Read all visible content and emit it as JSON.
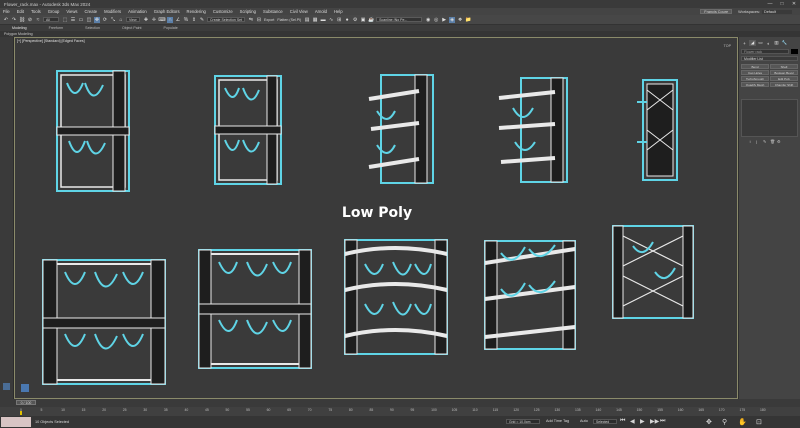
{
  "window": {
    "title": "Flower_rack.max - Autodesk 3ds Max 2024",
    "controls": [
      "—",
      "□",
      "✕"
    ]
  },
  "menu": {
    "items": [
      "File",
      "Edit",
      "Tools",
      "Group",
      "Views",
      "Create",
      "Modifiers",
      "Animation",
      "Graph Editors",
      "Rendering",
      "Customize",
      "Scripting",
      "Substance",
      "Civil View",
      "Arnold",
      "Help"
    ],
    "user": "Francis Coure",
    "workspaces_label": "Workspaces:",
    "workspaces_value": "Default"
  },
  "toolbar": {
    "selection_filter": "All",
    "reference_coord": "View",
    "create_selection_set": "Create Selection Set",
    "export_label": "Export",
    "flatten_label": "Flatten (Sel.Pl)",
    "render_preset": "Scanline (No Pe..."
  },
  "ribbon": {
    "tabs": [
      "Modeling",
      "Freeform",
      "Selection",
      "Object Paint",
      "Populate"
    ],
    "active_tab": "Modeling",
    "sub": "Polygon Modeling"
  },
  "viewport": {
    "label": "[+] [Perspective] [Standard] [Edged Faces]",
    "overlay_text": "Low Poly",
    "cube_label": "TOP"
  },
  "command_panel": {
    "tabs": [
      "+",
      "◢",
      "▭",
      "◐",
      "▥",
      "🔧"
    ],
    "object_name": "Flower rack",
    "modifier_list": "Modifier List",
    "buttons": [
      "Bend",
      "Shell",
      "Cap Holes",
      "Boolean Bevel",
      "TurboSmooth",
      "Edit Poly",
      "Quadify Mesh",
      "Chamfer Shift"
    ],
    "stack_icons": [
      "↕",
      "|",
      "✎",
      "🗑",
      "⚙"
    ]
  },
  "timeline": {
    "slider_label": "0 / 100",
    "ticks": [
      "0",
      "5",
      "10",
      "15",
      "20",
      "25",
      "30",
      "35",
      "40",
      "45",
      "50",
      "55",
      "60",
      "65",
      "70",
      "75",
      "80",
      "85",
      "90",
      "95",
      "100",
      "105",
      "110",
      "115",
      "120",
      "125",
      "130",
      "135",
      "140",
      "145",
      "150",
      "155",
      "160",
      "165",
      "170",
      "175",
      "180"
    ]
  },
  "status": {
    "objects_selected": "10 Objects Selected",
    "grid": "Grid = 10.0cm",
    "add_time_tag": "Add Time Tag",
    "auto_key": "Auto",
    "set_key_mode": "Selected",
    "playback_icons": [
      "⏮",
      "◀",
      "▶",
      "▶▶",
      "⏭"
    ]
  },
  "colors": {
    "wire": "#5fd4e6",
    "geometry_dark": "#1e1e1e",
    "geometry_edge": "#e9e9e9",
    "viewport_bg": "#3a3a3a",
    "accent": "#5b7fa8"
  }
}
